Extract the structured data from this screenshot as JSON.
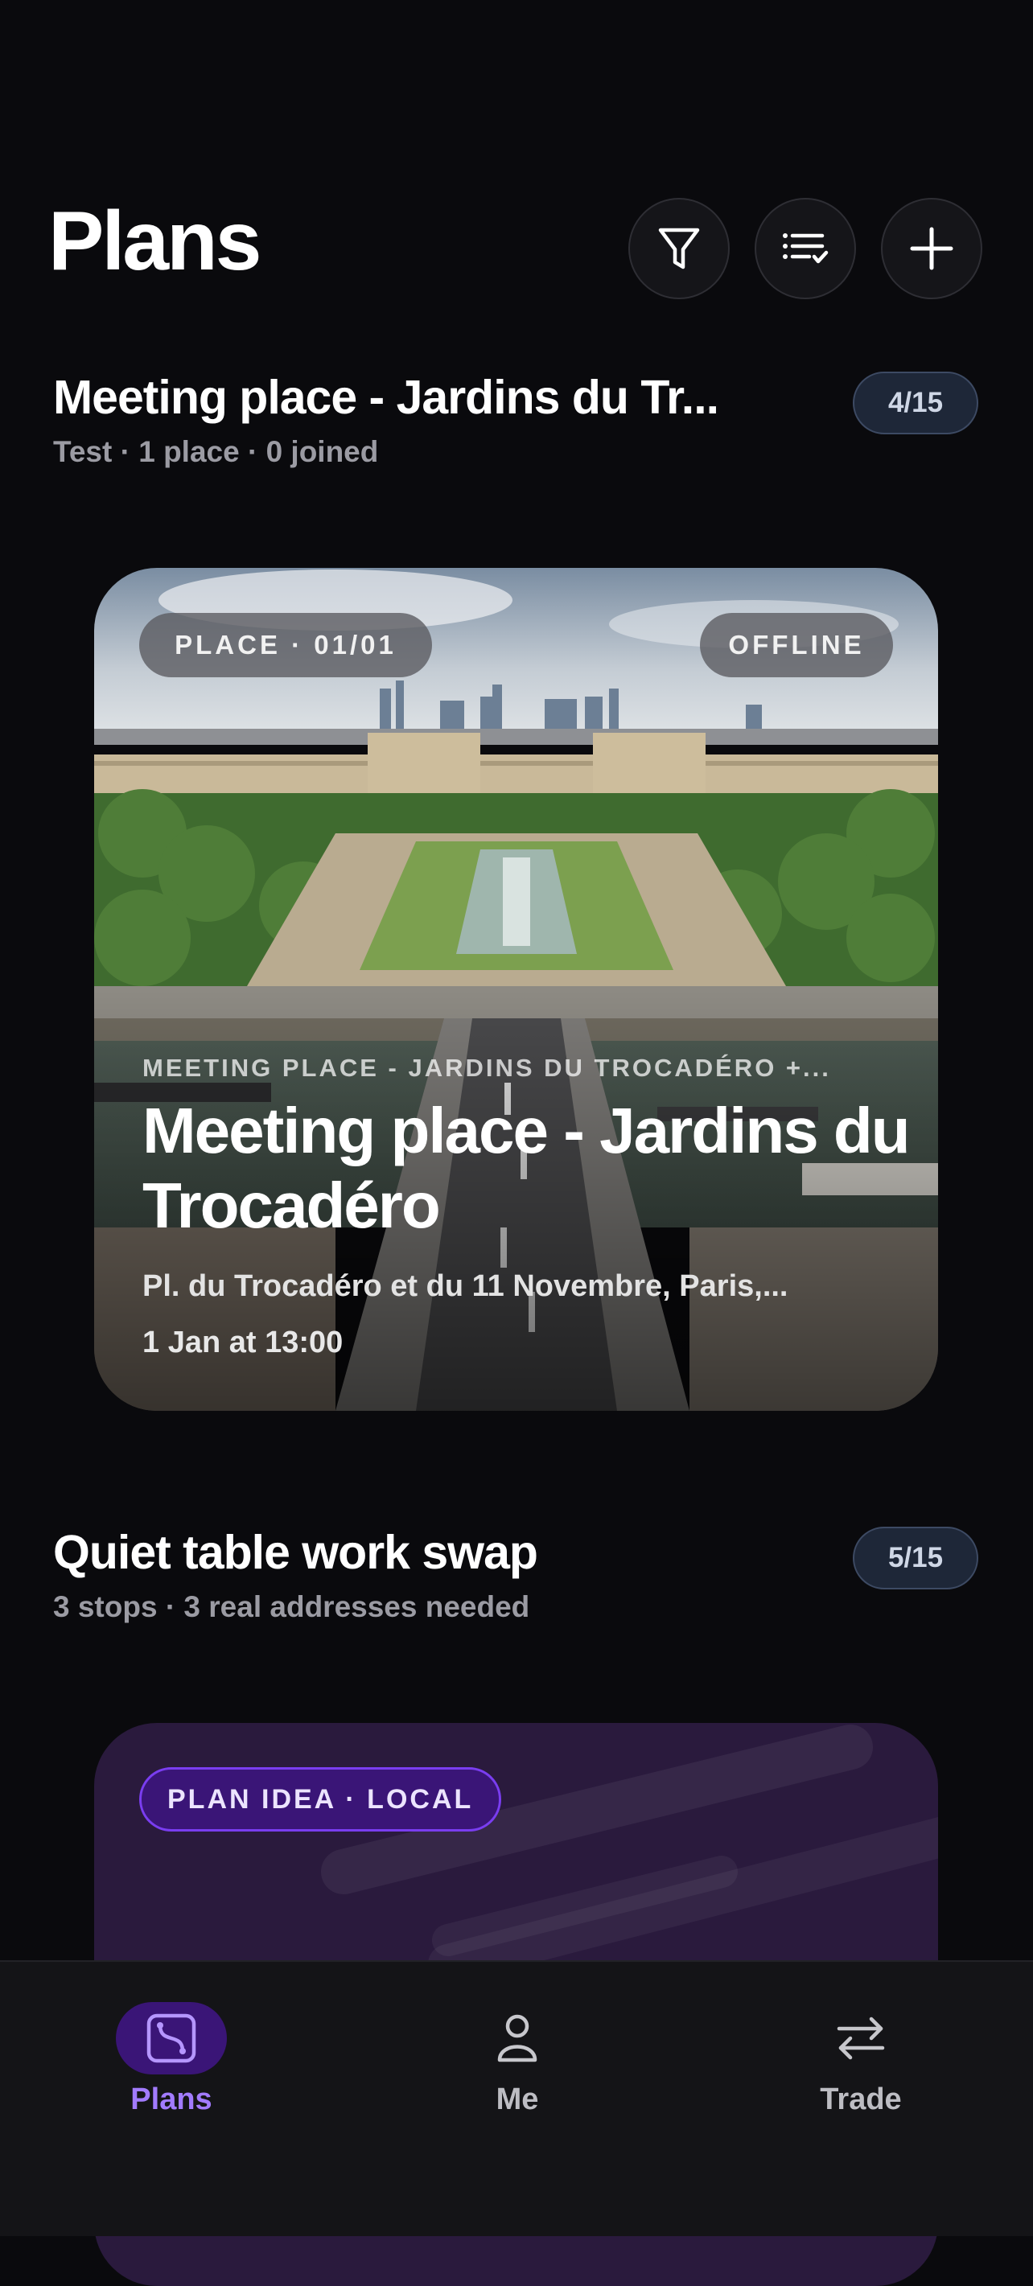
{
  "header": {
    "title": "Plans",
    "buttons": [
      {
        "name": "filter",
        "icon": "filter-icon"
      },
      {
        "name": "sort",
        "icon": "list-check-icon"
      },
      {
        "name": "add",
        "icon": "plus-icon"
      }
    ]
  },
  "plans": [
    {
      "title": "Meeting place - Jardins du Tr...",
      "subtitle": "Test · 1 place · 0 joined",
      "count": "4/15",
      "card": {
        "chip_left": "PLACE · 01/01",
        "chip_right": "OFFLINE",
        "kicker": "MEETING PLACE - JARDINS DU TROCADÉRO +...",
        "title": "Meeting place - Jardins du Trocadéro",
        "address": "Pl. du Trocadéro et du 11 Novembre, Paris,...",
        "time": "1 Jan at 13:00"
      }
    },
    {
      "title": "Quiet table work swap",
      "subtitle": "3 stops · 3 real addresses needed",
      "count": "5/15",
      "card": {
        "chip": "PLAN IDEA · LOCAL"
      }
    }
  ],
  "tabbar": {
    "tabs": [
      {
        "label": "Plans",
        "icon": "route-icon",
        "active": true
      },
      {
        "label": "Me",
        "icon": "person-icon",
        "active": false
      },
      {
        "label": "Trade",
        "icon": "swap-arrows-icon",
        "active": false
      }
    ]
  },
  "colors": {
    "background": "#0a0a0d",
    "accent": "#9b6cf6",
    "accent_bg": "#3a1577",
    "pill_bg": "#1e2738"
  }
}
